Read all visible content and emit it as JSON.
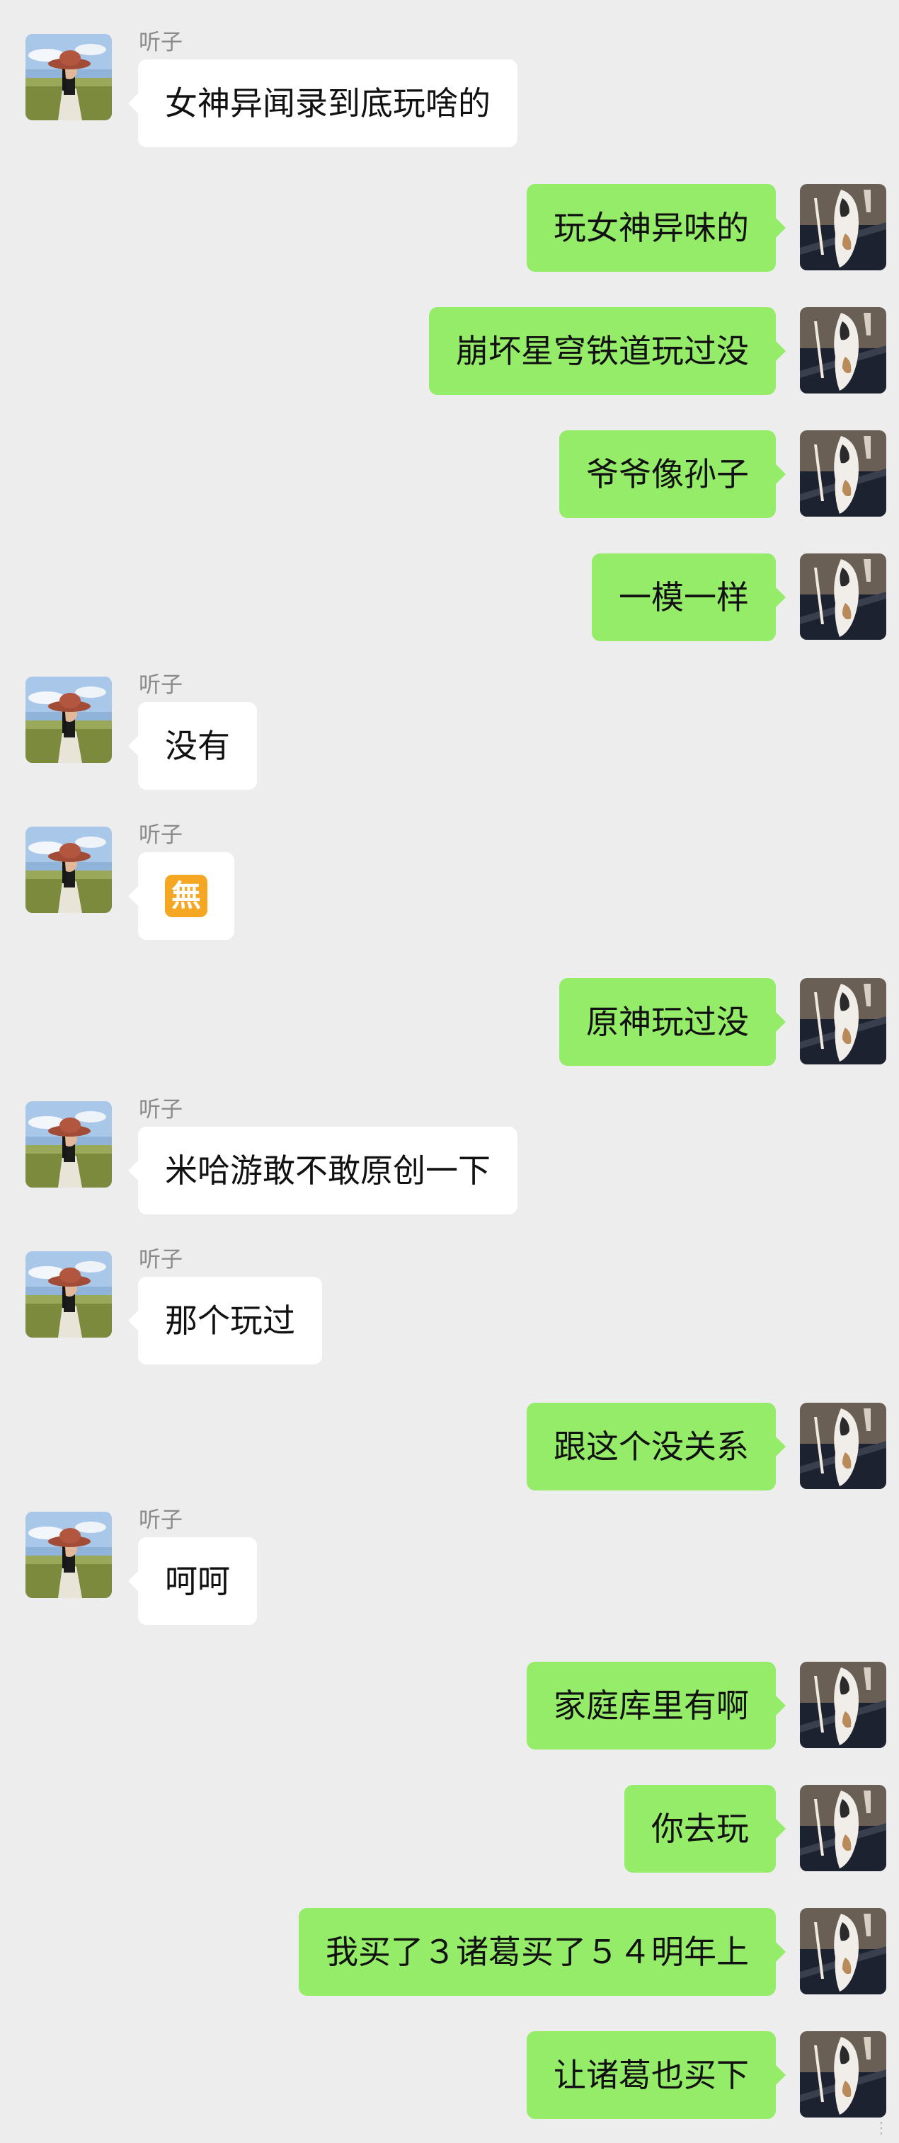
{
  "chat": {
    "contact_name": "听子",
    "messages": [
      {
        "side": "left",
        "sender": "听子",
        "text": "女神异闻录到底玩啥的"
      },
      {
        "side": "right",
        "text": "玩女神异味的"
      },
      {
        "side": "right",
        "text": "崩坏星穹铁道玩过没"
      },
      {
        "side": "right",
        "text": "爷爷像孙子"
      },
      {
        "side": "right",
        "text": "一模一样"
      },
      {
        "side": "left",
        "sender": "听子",
        "text": "没有"
      },
      {
        "side": "left",
        "sender": "听子",
        "text": "",
        "emoji": "無"
      },
      {
        "side": "right",
        "text": "原神玩过没"
      },
      {
        "side": "left",
        "sender": "听子",
        "text": "米哈游敢不敢原创一下"
      },
      {
        "side": "left",
        "sender": "听子",
        "text": "那个玩过"
      },
      {
        "side": "right",
        "text": "跟这个没关系"
      },
      {
        "side": "left",
        "sender": "听子",
        "text": "呵呵"
      },
      {
        "side": "right",
        "text": "家庭库里有啊"
      },
      {
        "side": "right",
        "text": "你去玩"
      },
      {
        "side": "right",
        "text": "我买了３诸葛买了５４明年上"
      },
      {
        "side": "right",
        "text": "让诸葛也买下"
      }
    ]
  },
  "icons": {
    "contact_avatar": "woman-in-hat-avatar-icon",
    "self_avatar": "cat-avatar-icon"
  },
  "colors": {
    "background": "#ededed",
    "incoming_bubble": "#ffffff",
    "outgoing_bubble": "#95ec69",
    "sender_name": "#8a8a8a"
  },
  "watermark": "⋮"
}
